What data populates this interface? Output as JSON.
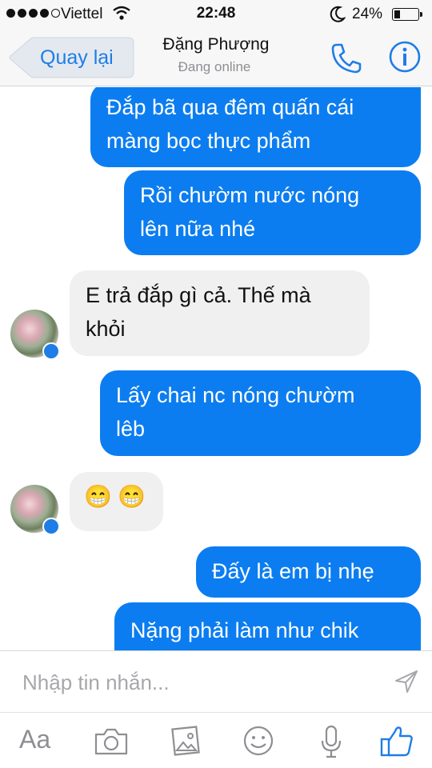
{
  "status_bar": {
    "carrier": "Viettel",
    "time": "22:48",
    "battery_percent": "24%",
    "battery_level": 0.24,
    "icons": [
      "signal-dots-icon",
      "wifi-icon",
      "moon-icon",
      "battery-icon"
    ]
  },
  "nav": {
    "back_label": "Quay lại",
    "contact_name": "Đặng Phượng",
    "contact_status": "Đang online",
    "icons": [
      "phone-icon",
      "info-icon"
    ]
  },
  "messages": [
    {
      "direction": "outgoing",
      "lines": [
        "Đắp bã qua đêm quấn cái",
        "màng bọc thực phẩm"
      ]
    },
    {
      "direction": "outgoing",
      "lines": [
        "Rồi chườm nước nóng",
        "lên nữa nhé"
      ]
    },
    {
      "direction": "incoming",
      "lines": [
        "E trả đắp gì cả. Thế mà",
        "khỏi"
      ]
    },
    {
      "direction": "outgoing",
      "lines": [
        "Lấy chai nc nóng chườm",
        "lêb"
      ]
    },
    {
      "direction": "incoming",
      "emoji": [
        "😁",
        "😁"
      ]
    },
    {
      "direction": "outgoing",
      "lines": [
        "Đấy là em bị nhẹ"
      ]
    },
    {
      "direction": "outgoing",
      "lines": [
        "Nặng phải làm như chik"
      ]
    }
  ],
  "composer": {
    "placeholder": "Nhập tin nhắn...",
    "font_button": "Aa",
    "toolbar_icons": [
      "camera-icon",
      "photo-icon",
      "emoji-icon",
      "microphone-icon",
      "like-icon"
    ],
    "accent": "#1e7de6"
  },
  "colors": {
    "outgoing_bubble": "#0c7df0",
    "incoming_bubble": "#f1f0f0",
    "link_blue": "#1e7de6"
  }
}
